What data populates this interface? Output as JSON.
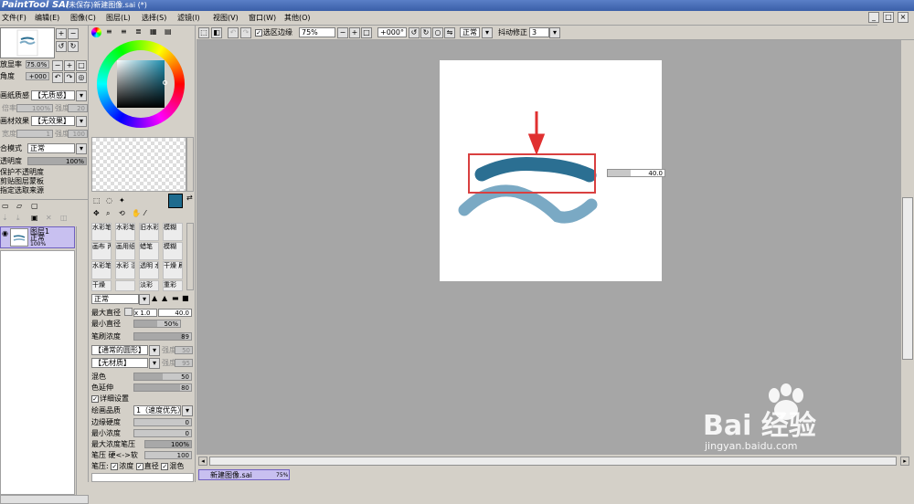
{
  "window": {
    "logo": "PaintTool SAI",
    "title": "(未保存)新建图像.sai (*)",
    "controls": [
      "_",
      "□",
      "×"
    ]
  },
  "menu": [
    "文件(F)",
    "编辑(E)",
    "图像(C)",
    "图层(L)",
    "选择(S)",
    "滤镜(I)",
    "视图(V)",
    "窗口(W)",
    "其他(O)"
  ],
  "navigator": {
    "zoom_label": "放显率",
    "zoom_value": "75.0%",
    "angle_label": "角度",
    "angle_value": "+000"
  },
  "paper": {
    "texture_label": "画纸质感",
    "texture_value": "【无质感】",
    "texture_scale_label": "倍率",
    "texture_scale": "100%",
    "texture_strength_label": "强度",
    "texture_strength": "20",
    "effect_label": "画材效果",
    "effect_value": "【无效果】",
    "effect_width_label": "宽度",
    "effect_width": "1",
    "effect_strength_label": "强度",
    "effect_strength": "100"
  },
  "layer": {
    "blend_label": "合模式",
    "blend_value": "正常",
    "opacity_label": "透明度",
    "opacity_value": "100%",
    "opacity_fraction": 1.0,
    "protect_opacity": "保护不透明度",
    "clip_group": "剪贴图层蒙板",
    "select_source": "指定选取来源",
    "item_name": "图层1",
    "item_mode": "正常",
    "item_opacity": "100%"
  },
  "colors": {
    "main": "#1e6b8e",
    "stroke_top": "#2b6f92",
    "stroke_bottom": "#7aa9c4",
    "arrow": "#e03030",
    "highlight_box": "#d94040"
  },
  "brushes": [
    [
      "水彩笔 9数",
      "水彩笔 10数",
      "旧水彩",
      "模糊"
    ],
    [
      "画布 丙烯",
      "画用纸 丙烯",
      "蜡笔",
      "模糊"
    ],
    [
      "水彩笔",
      "水彩 湿润",
      "透明 水彩",
      "干燥 刷子"
    ],
    [
      "干燥",
      "",
      "淡彩",
      "重彩"
    ]
  ],
  "brush_settings": {
    "mode_value": "正常",
    "max_diameter_label": "最大直径",
    "max_multiplier": "x 1.0",
    "max_diameter": "40.0",
    "min_diameter_label": "最小直径",
    "min_diameter": "50%",
    "min_fraction": 0.5,
    "density_label": "笔刷浓度",
    "density": "89",
    "density_fraction": 0.89,
    "shape_value": "【通常的圆形】",
    "shape_strength_label": "强度",
    "shape_strength": "50",
    "texture_value": "【无材质】",
    "texture_strength_label": "强度",
    "texture_strength": "95",
    "mix_label": "混色",
    "mix": "50",
    "mix_fraction": 0.5,
    "extend_label": "色延伸",
    "extend": "80",
    "extend_fraction": 0.8,
    "detail_label": "详细设置",
    "quality_label": "绘画品质",
    "quality_value": "1（速度优先）",
    "edge_label": "边缘硬度",
    "edge": "0",
    "min_density_label": "最小浓度",
    "min_density": "0",
    "max_pressure_label": "最大浓度笔压",
    "max_pressure": "100%",
    "pressure_hard_label": "笔压 硬<->软",
    "pressure_hard": "100",
    "pressure_label": "笔压:",
    "pressure_density": "浓度",
    "pressure_diameter": "直径",
    "pressure_mix": "混色"
  },
  "toolbar": {
    "selection_edge": "选区边缘",
    "zoom": "75%",
    "angle": "+000°",
    "mode": "正常",
    "stabilizer_label": "抖动修正",
    "stabilizer": "3"
  },
  "canvas": {
    "size_readout": "40.0"
  },
  "status": {
    "doc_name": "新建图像.sai",
    "doc_zoom": "75%"
  },
  "watermark": {
    "brand": "Bai 经验",
    "url": "jingyan.baidu.com"
  }
}
